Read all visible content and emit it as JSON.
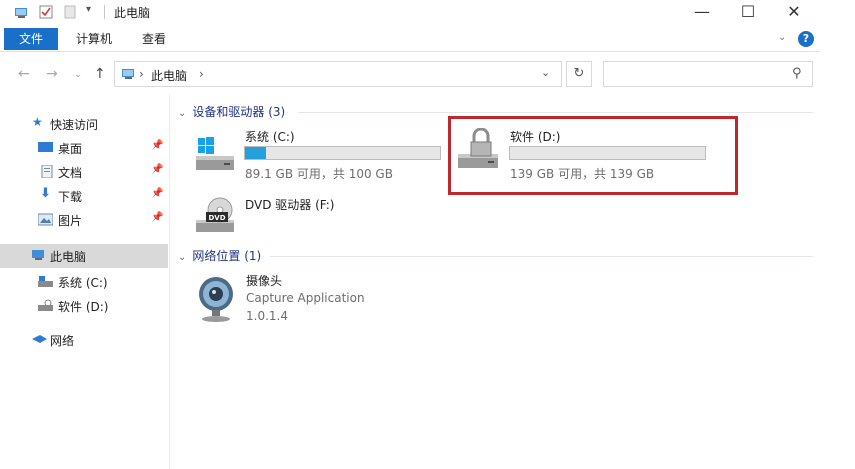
{
  "window": {
    "title": "此电脑",
    "controls": {
      "minimize": "—",
      "maximize": "☐",
      "close": "✕"
    }
  },
  "ribbon": {
    "tabs": [
      "文件",
      "计算机",
      "查看"
    ],
    "help": "?"
  },
  "address": {
    "path": [
      "此电脑"
    ],
    "separator": "›",
    "search_placeholder": ""
  },
  "nav": {
    "quick_access": "快速访问",
    "pinned": [
      "桌面",
      "文档",
      "下载",
      "图片"
    ],
    "this_pc": "此电脑",
    "drives": [
      "系统 (C:)",
      "软件 (D:)"
    ],
    "network": "网络"
  },
  "content": {
    "devices_group": "设备和驱动器 (3)",
    "network_group": "网络位置 (1)",
    "drives": [
      {
        "name": "系统 (C:)",
        "space": "89.1 GB 可用，共 100 GB",
        "used_fraction": 0.11
      },
      {
        "name": "软件 (D:)",
        "space": "139 GB 可用，共 139 GB",
        "used_fraction": 0.0
      },
      {
        "name": "DVD 驱动器 (F:)",
        "dvd_badge": "DVD"
      }
    ],
    "network_items": [
      {
        "name": "摄像头",
        "line2": "Capture Application",
        "line3": "1.0.1.4"
      }
    ]
  },
  "colors": {
    "accent": "#1a6fc9",
    "bar_fill": "#26a0da",
    "highlight": "#c0272d"
  }
}
